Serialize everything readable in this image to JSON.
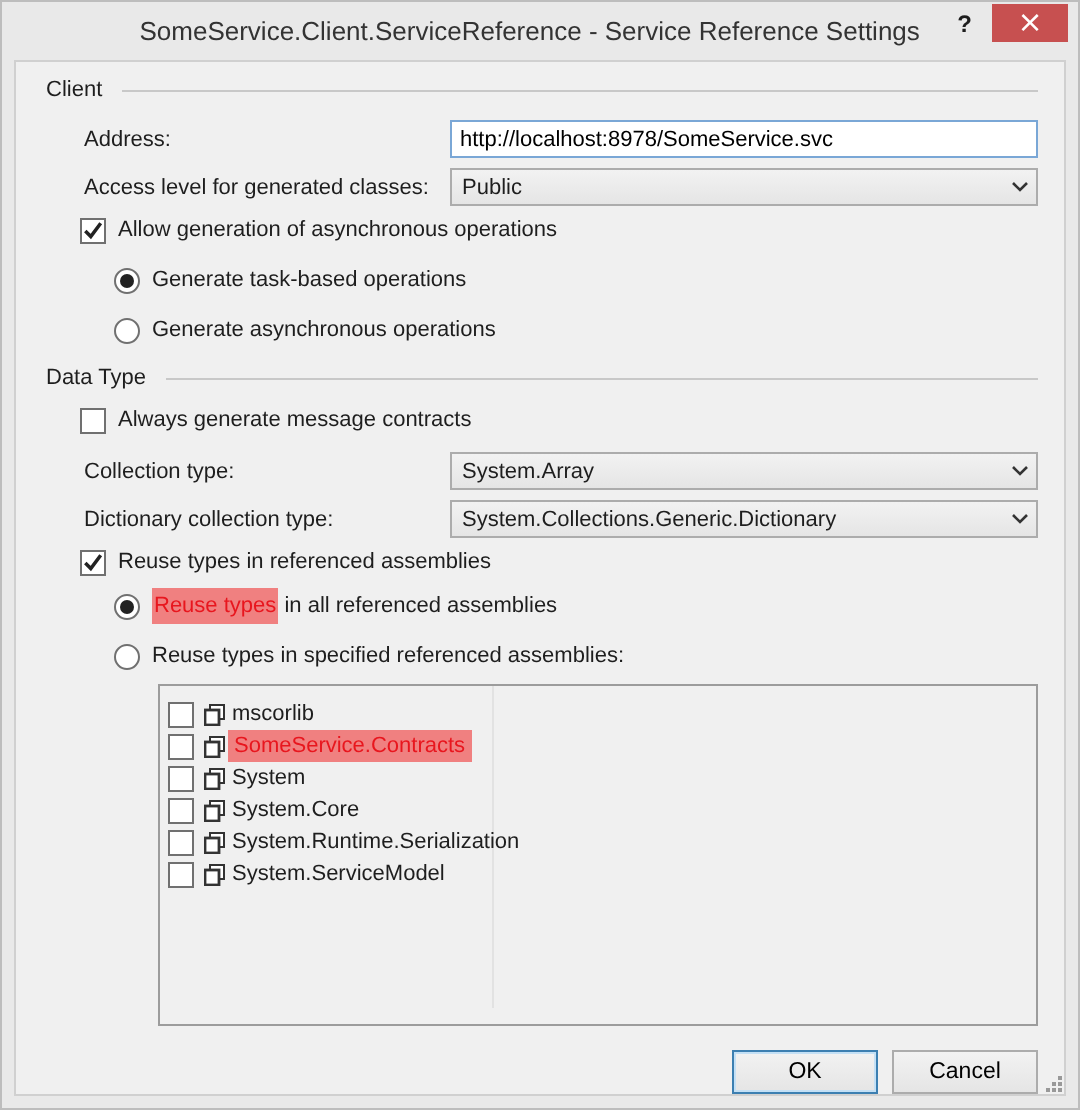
{
  "window": {
    "title": "SomeService.Client.ServiceReference - Service Reference Settings",
    "help": "?",
    "close": "×"
  },
  "client": {
    "heading": "Client",
    "fields": [
      {
        "kind": "text",
        "label": "Address:",
        "value": "http://localhost:8978/SomeService.svc"
      },
      {
        "kind": "select",
        "label": "Access level for generated classes:",
        "value": "Public"
      }
    ],
    "async_checkbox": {
      "label": "Allow generation of asynchronous operations",
      "checked": true
    },
    "async_options": [
      {
        "label": "Generate task-based operations",
        "selected": true
      },
      {
        "label": "Generate asynchronous operations",
        "selected": false
      }
    ]
  },
  "data_type": {
    "heading": "Data Type",
    "message_contracts": {
      "label": "Always generate message contracts",
      "checked": false
    },
    "fields": [
      {
        "kind": "select",
        "label": "Collection type:",
        "value": "System.Array"
      },
      {
        "kind": "select",
        "label": "Dictionary collection type:",
        "value": "System.Collections.Generic.Dictionary"
      }
    ],
    "reuse_checkbox": {
      "label": "Reuse types in referenced assemblies",
      "checked": true
    },
    "reuse_options": [
      {
        "label_parts": [
          {
            "text": "Reuse types",
            "highlighted": true
          },
          {
            "text": " in all referenced assemblies",
            "highlighted": false
          }
        ],
        "selected": true
      },
      {
        "label_parts": [
          {
            "text": "Reuse types in specified referenced assemblies:",
            "highlighted": false
          }
        ],
        "selected": false
      }
    ],
    "assemblies": [
      {
        "name": "mscorlib",
        "checked": false,
        "highlighted": false
      },
      {
        "name": "SomeService.Contracts",
        "checked": false,
        "highlighted": true
      },
      {
        "name": "System",
        "checked": false,
        "highlighted": false
      },
      {
        "name": "System.Core",
        "checked": false,
        "highlighted": false
      },
      {
        "name": "System.Runtime.Serialization",
        "checked": false,
        "highlighted": false
      },
      {
        "name": "System.ServiceModel",
        "checked": false,
        "highlighted": false
      }
    ]
  },
  "buttons": [
    {
      "label": "OK",
      "default": true
    },
    {
      "label": "Cancel",
      "default": false
    }
  ]
}
